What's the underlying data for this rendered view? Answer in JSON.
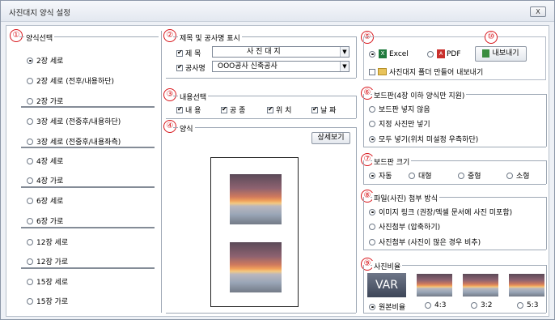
{
  "window": {
    "title": "사진대지 양식 설정",
    "close_label": "X"
  },
  "layout_group": {
    "number": "①",
    "title": "양식선택",
    "options": [
      {
        "label": "2장 세로",
        "selected": true
      },
      {
        "label": "2장 세로 (전후/내용하단)",
        "selected": false
      },
      {
        "label": "2장 가로",
        "selected": false
      },
      {
        "label": "3장 세로 (전중후/내용하단)",
        "selected": false
      },
      {
        "label": "3장 세로 (전중후/내용좌측)",
        "selected": false
      },
      {
        "label": "4장 세로",
        "selected": false
      },
      {
        "label": "4장 가로",
        "selected": false
      },
      {
        "label": "6장 세로",
        "selected": false
      },
      {
        "label": "6장 가로",
        "selected": false
      },
      {
        "label": "12장 세로",
        "selected": false
      },
      {
        "label": "12장 가로",
        "selected": false
      },
      {
        "label": "15장 세로",
        "selected": false
      },
      {
        "label": "15장 가로",
        "selected": false
      }
    ]
  },
  "title_group": {
    "number": "②",
    "title": "제목 및 공사명 표시",
    "title_check_label": "제 목",
    "title_value": "사 진 대 지",
    "project_check_label": "공사명",
    "project_value": "OOO공사 신축공사"
  },
  "content_group": {
    "number": "③",
    "title": "내용선택",
    "items": [
      "내 용",
      "공 종",
      "위 치",
      "날 짜"
    ]
  },
  "preview_group": {
    "number": "④",
    "title": "양식",
    "detail_button": "상세보기"
  },
  "export_group": {
    "number": "⑤",
    "excel_label": "Excel",
    "pdf_label": "PDF",
    "export_number": "⑩",
    "export_button": "내보내기",
    "folder_check_label": "사진대지 폴더 만들어 내보내기"
  },
  "board_group": {
    "number": "⑥",
    "title": "보드판(4장 이하 양식만 지원)",
    "options": [
      {
        "label": "보드판 넣지 않음",
        "selected": false
      },
      {
        "label": "지정 사진만 넣기",
        "selected": false
      },
      {
        "label": "모두 넣기(위치 미설정 우측하단)",
        "selected": true
      }
    ]
  },
  "board_size_group": {
    "number": "⑦",
    "title": "보드판 크기",
    "options": [
      {
        "label": "자동",
        "selected": true
      },
      {
        "label": "대형",
        "selected": false
      },
      {
        "label": "중형",
        "selected": false
      },
      {
        "label": "소형",
        "selected": false
      }
    ]
  },
  "attach_group": {
    "number": "⑧",
    "title": "파일(사진) 첨부 방식",
    "options": [
      {
        "label": "이미지 링크 (권장/엑셀 문서에 사진 미포함)",
        "selected": true
      },
      {
        "label": "사진첨부 (압축하기)",
        "selected": false
      },
      {
        "label": "사진첨부 (사진이 많은 경우 비추)",
        "selected": false
      }
    ]
  },
  "ratio_group": {
    "number": "⑨",
    "title": "사진비율",
    "first_thumb_text": "VAR",
    "options": [
      {
        "label": "원본비율",
        "selected": true
      },
      {
        "label": "4:3",
        "selected": false
      },
      {
        "label": "3:2",
        "selected": false
      },
      {
        "label": "5:3",
        "selected": false
      }
    ]
  }
}
